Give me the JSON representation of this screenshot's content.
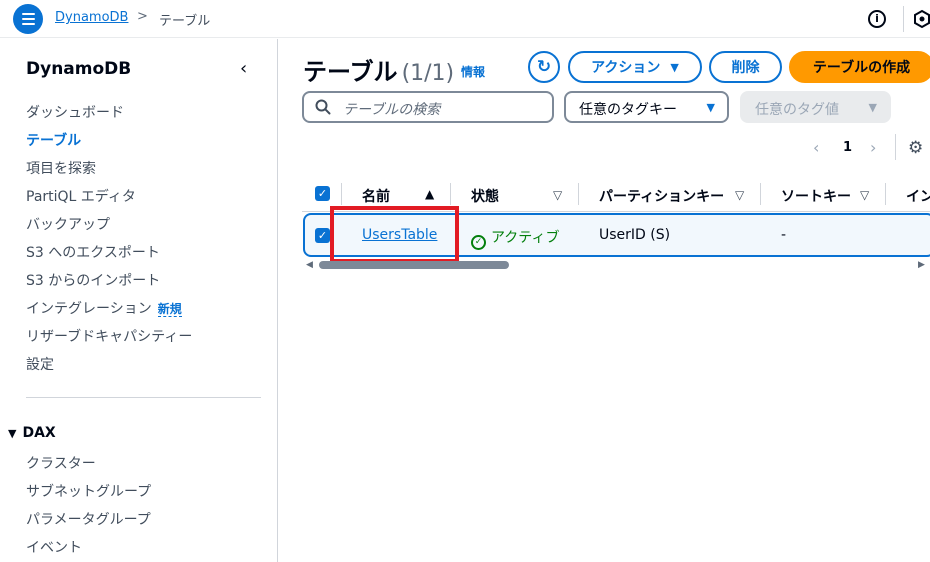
{
  "topbar": {
    "breadcrumb_service": "DynamoDB",
    "breadcrumb_separator": ">",
    "breadcrumb_current": "テーブル",
    "info_glyph": "i"
  },
  "sidebar": {
    "title": "DynamoDB",
    "collapse_glyph": "‹",
    "items": [
      {
        "label": "ダッシュボード"
      },
      {
        "label": "テーブル",
        "active": true
      },
      {
        "label": "項目を探索"
      },
      {
        "label": "PartiQL エディタ"
      },
      {
        "label": "バックアップ"
      },
      {
        "label": "S3 へのエクスポート"
      },
      {
        "label": "S3 からのインポート"
      },
      {
        "label": "インテグレーション",
        "badge": "新規"
      },
      {
        "label": "リザーブドキャパシティー"
      },
      {
        "label": "設定"
      }
    ],
    "dax_group": {
      "label": "DAX",
      "caret": "▼",
      "items": [
        {
          "label": "クラスター"
        },
        {
          "label": "サブネットグループ"
        },
        {
          "label": "パラメータグループ"
        },
        {
          "label": "イベント"
        }
      ]
    }
  },
  "header": {
    "title": "テーブル",
    "count": "(1/1)",
    "info_link": "情報",
    "refresh_glyph": "↻",
    "actions_label": "アクション",
    "dropdown_glyph": "▼",
    "delete_label": "削除",
    "create_label": "テーブルの作成"
  },
  "filters": {
    "search_placeholder": "テーブルの検索",
    "tag_key_label": "任意のタグキー",
    "tag_value_label": "任意のタグ値"
  },
  "pagination": {
    "prev_glyph": "‹",
    "current_page": "1",
    "next_glyph": "›",
    "settings_glyph": "⚙"
  },
  "table": {
    "check_glyph": "✓",
    "sort_asc_glyph": "▲",
    "sort_glyph": "▽",
    "columns": [
      "名前",
      "状態",
      "パーティションキー",
      "ソートキー",
      "イン"
    ],
    "rows": [
      {
        "name": "UsersTable",
        "status": "アクティブ",
        "status_glyph": "✓",
        "partition_key": "UserID (S)",
        "sort_key": "-",
        "selected": true
      }
    ]
  },
  "scrollbar": {
    "left_glyph": "◀",
    "right_glyph": "▶"
  },
  "colors": {
    "accent": "#0972d3",
    "primary_button": "#ff9900",
    "status_active": "#037f0c",
    "annotation_highlight": "#e21b24"
  }
}
